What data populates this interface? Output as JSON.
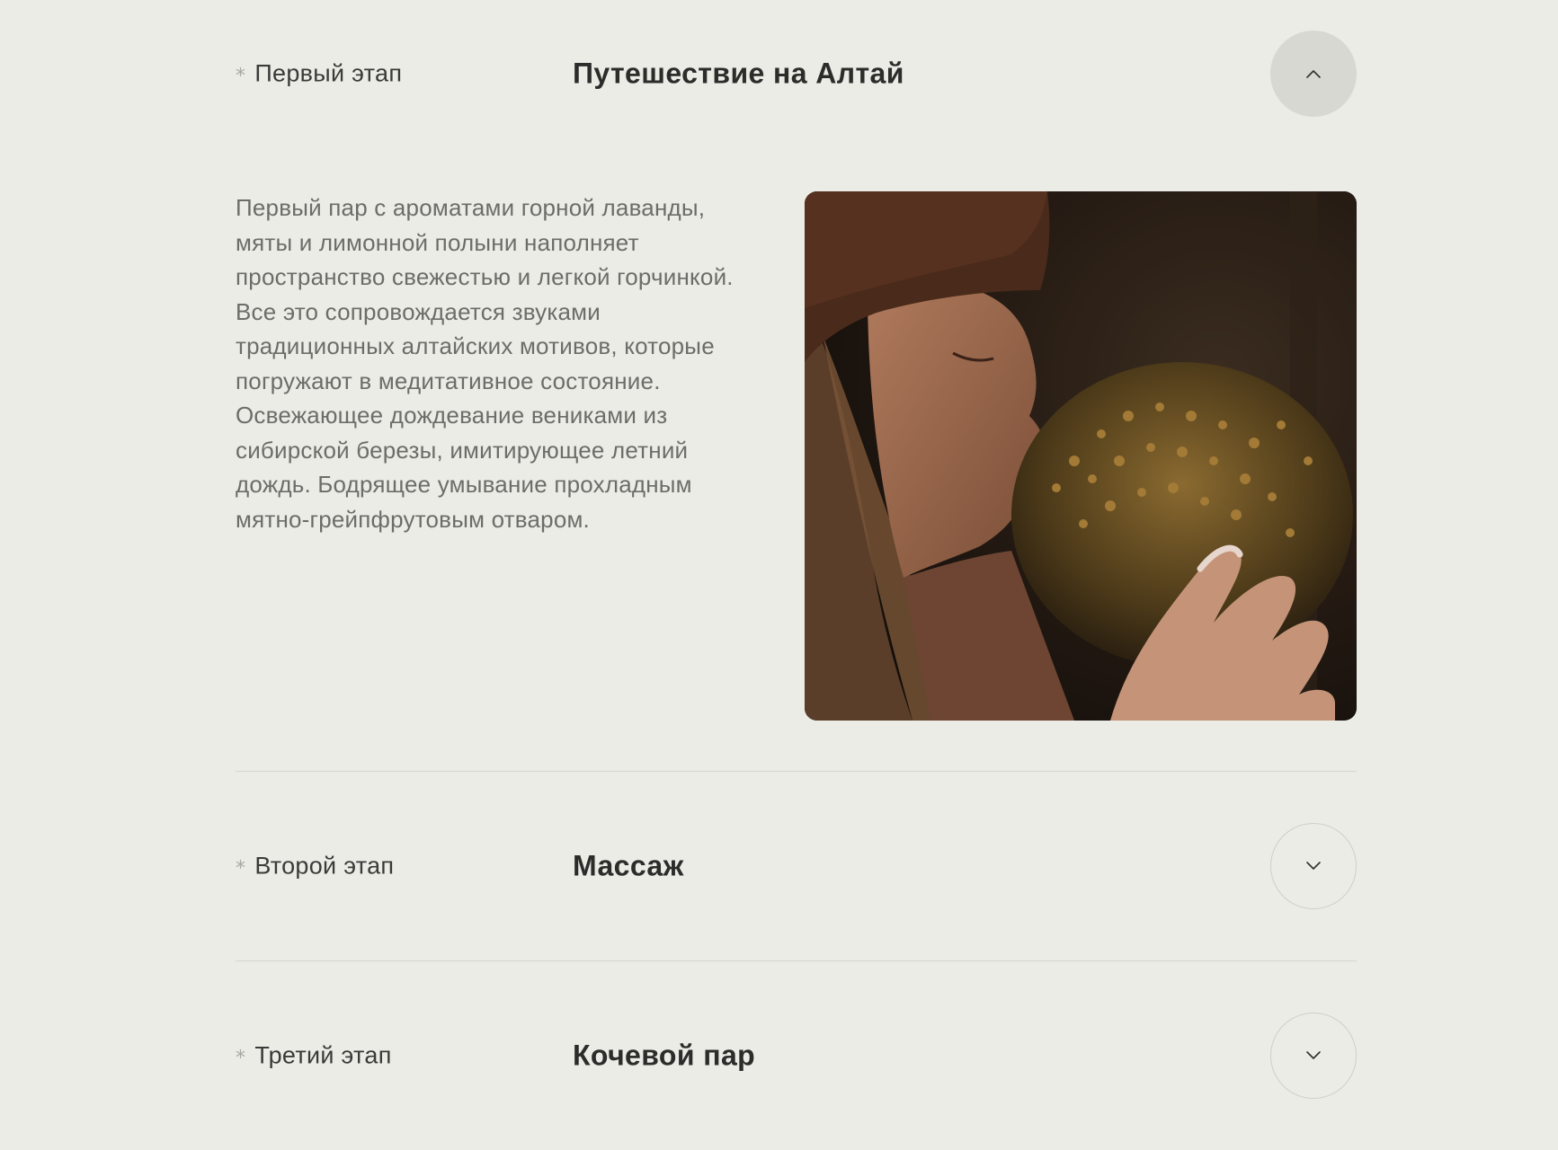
{
  "steps": [
    {
      "label": "Первый этап",
      "title": "Путешествие на Алтай",
      "expanded": true,
      "paragraphs": [
        "Первый пар с ароматами горной лаванды, мяты и лимонной полыни наполняет пространство свежестью и легкой горчинкой.",
        "Все это сопровождается звуками традиционных алтайских мотивов, которые погружают в медитативное состояние.",
        "Освежающее дождевание вениками из сибирской березы, имитирующее летний дождь. Бодрящее умывание прохладным мятно-грейпфрутовым отваром."
      ],
      "toggle_icon": "chevron-up-icon"
    },
    {
      "label": "Второй этап",
      "title": "Массаж",
      "expanded": false,
      "toggle_icon": "chevron-down-icon"
    },
    {
      "label": "Третий этап",
      "title": "Кочевой пар",
      "expanded": false,
      "toggle_icon": "chevron-down-icon"
    }
  ],
  "colors": {
    "background": "#ecece7",
    "text_dark": "#2c2c2a",
    "text_muted": "#6c6c69",
    "divider": "#d6d6d1",
    "toggle_active": "#d8d8d3"
  },
  "icons": {
    "bullet": "asterisk-icon"
  }
}
